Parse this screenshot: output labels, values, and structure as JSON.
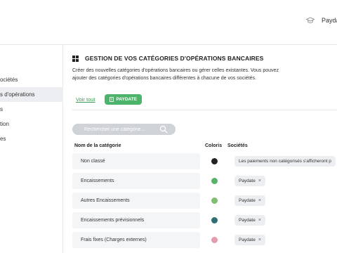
{
  "header": {
    "user_name": "Payda"
  },
  "sidebar": {
    "items": [
      {
        "label": "ociétés",
        "active": false
      },
      {
        "label": "s d'opérations",
        "active": true
      },
      {
        "label": "s",
        "active": false
      },
      {
        "label": "tion",
        "active": false
      },
      {
        "label": "es",
        "active": false
      }
    ]
  },
  "main": {
    "title": "GESTION DE VOS CATÉGORIES D'OPÉRATIONS BANCAIRES",
    "description": "Créer des nouvelles catégories d'opérations bancaires ou gérer celles existantes. Vous pouvez ajouter des catégories d'opérations bancaires différentes à chacune de vos sociétés.",
    "view_all_label": "Voir tout",
    "company_chip_label": "PAYDATE",
    "search_placeholder": "Rechercher une catégorie...",
    "columns": {
      "name": "Nom de la catégorie",
      "color": "Coloris",
      "companies": "Sociétés"
    },
    "rows": [
      {
        "name": "Non classé",
        "color": "#222222",
        "company": "Les paiements non catégorisés s'afficheront p",
        "removable": false
      },
      {
        "name": "Encaissements",
        "color": "#56b468",
        "company": "Paydate",
        "removable": true
      },
      {
        "name": "Autres Encaissements",
        "color": "#7fbf6d",
        "company": "Paydate",
        "removable": true
      },
      {
        "name": "Encaissements prévisionnels",
        "color": "#2d6f73",
        "company": "Paydate",
        "removable": true
      },
      {
        "name": "Frais fixes (Charges externes)",
        "color": "#e79aae",
        "company": "Paydate",
        "removable": true
      }
    ]
  },
  "colors": {
    "accent_green": "#4cb46a",
    "link_green": "#3a9a52"
  },
  "icons": {
    "header": "graduation-cap-icon",
    "title": "grid-icon",
    "chip": "building-icon",
    "search": "search-icon",
    "remove": "close-icon"
  }
}
